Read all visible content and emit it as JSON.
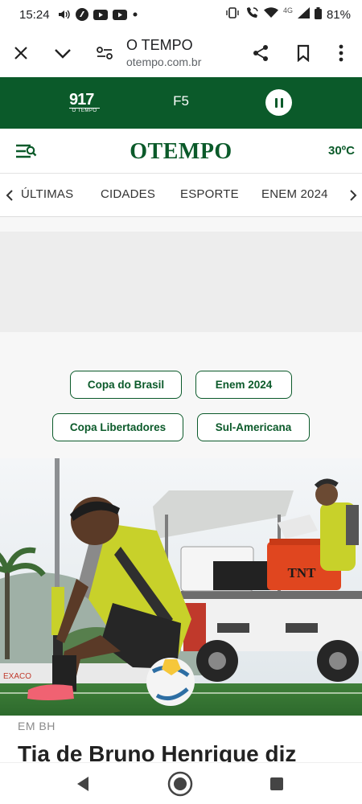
{
  "status_bar": {
    "time": "15:24",
    "battery": "81%",
    "network": "4G",
    "icons": [
      "volume-icon",
      "app-icon",
      "youtube-icon",
      "youtube-icon",
      "dot-icon",
      "vibrate-icon",
      "wifi-call-icon",
      "wifi-icon",
      "signal-icon",
      "battery-icon"
    ]
  },
  "browser": {
    "title": "O TEMPO",
    "url": "otempo.com.br",
    "icons": [
      "close-icon",
      "chevron-down-icon",
      "page-settings-icon",
      "share-icon",
      "bookmark-icon",
      "more-icon"
    ]
  },
  "radio": {
    "logo_number": "917",
    "logo_sub": "O TEMPO",
    "station": "F5",
    "control_icon": "pause-icon"
  },
  "header": {
    "logo": "OTEMPO",
    "temperature": "30ºC",
    "menu_icon": "menu-search-icon"
  },
  "nav": {
    "items": [
      "ÚLTIMAS",
      "CIDADES",
      "ESPORTE",
      "ENEM 2024"
    ],
    "left_icon": "chevron-left-icon",
    "right_icon": "chevron-right-icon"
  },
  "tags": [
    "Copa do Brasil",
    "Enem 2024",
    "Copa Libertadores",
    "Sul-Americana"
  ],
  "article": {
    "kicker": "EM BH",
    "headline": "Tia de Bruno Henrique diz",
    "image_logo_text": "TNT"
  },
  "colors": {
    "brand_green": "#0b5a2a",
    "background": "#ffffff",
    "ad_gray": "#ededed"
  },
  "system_nav": [
    "back-icon",
    "home-icon",
    "recents-icon"
  ]
}
